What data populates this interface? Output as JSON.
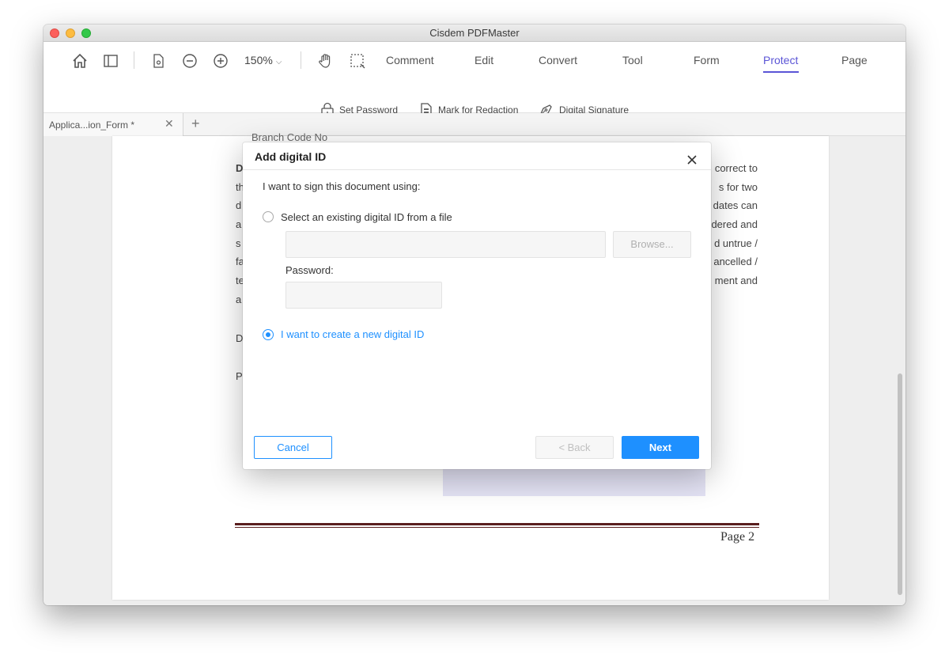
{
  "window": {
    "title": "Cisdem PDFMaster"
  },
  "toolbar": {
    "zoom": "150%",
    "tabs": [
      "Comment",
      "Edit",
      "Convert",
      "Tool",
      "Form",
      "Protect",
      "Page"
    ],
    "active_tab": "Protect",
    "sub_tools": [
      "Set Password",
      "Mark for Redaction",
      "Digital Signature"
    ]
  },
  "tabs": {
    "doc_tab": "Applica...ion_Form *"
  },
  "document": {
    "header_fragment": "Branch Code No",
    "left_fragments": [
      "D",
      "th",
      "d",
      "a",
      "s",
      "fa",
      "te",
      "a",
      "D",
      "P"
    ],
    "right_fragments": [
      "correct to",
      "s for two",
      "dates can",
      "dered and",
      "d untrue /",
      "ancelled /",
      "ment and"
    ],
    "page_number": "Page 2"
  },
  "dialog": {
    "title": "Add digital ID",
    "prompt": "I want to sign this document using:",
    "option_existing": "Select an existing digital ID from a file",
    "browse_label": "Browse...",
    "password_label": "Password:",
    "option_new": "I want to create a new digital ID",
    "cancel_label": "Cancel",
    "back_label": "< Back",
    "next_label": "Next"
  }
}
